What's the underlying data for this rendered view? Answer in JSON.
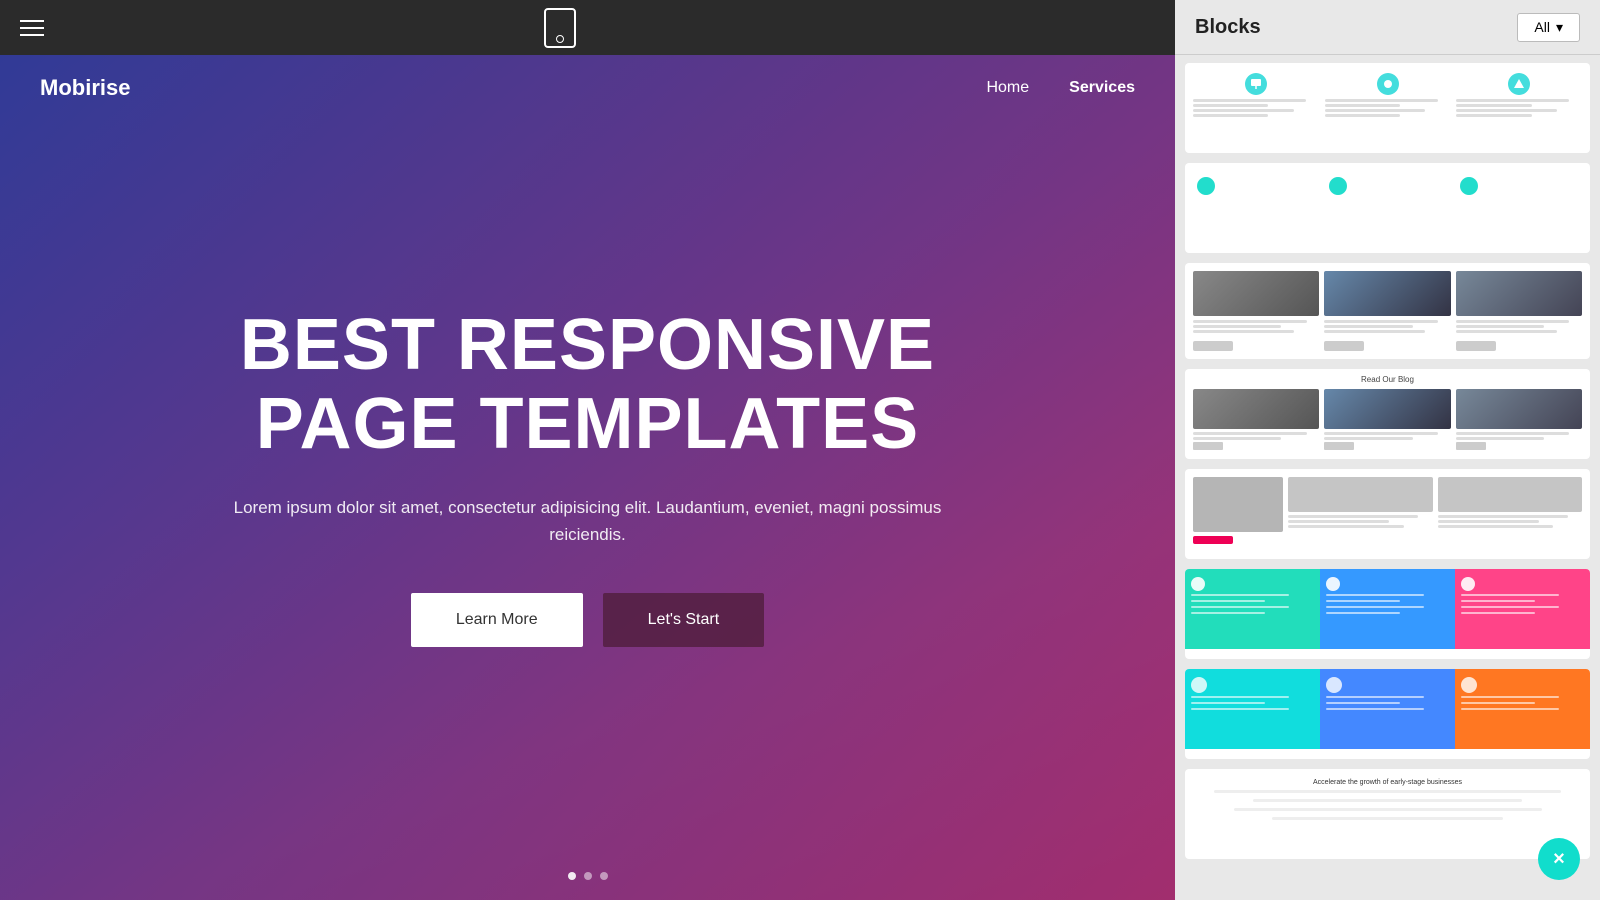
{
  "toolbar": {
    "device_icon_label": "mobile device"
  },
  "navbar": {
    "brand": "Mobirise",
    "links": [
      {
        "label": "Home",
        "active": false
      },
      {
        "label": "Services",
        "active": true
      }
    ]
  },
  "hero": {
    "title_line1": "BEST RESPONSIVE",
    "title_line2": "PAGE TEMPLATES",
    "subtitle": "Lorem ipsum dolor sit amet, consectetur adipisicing elit. Laudantium, eveniet, magni possimus reiciendis.",
    "btn_learn": "Learn More",
    "btn_start": "Let's Start"
  },
  "right_panel": {
    "title": "Blocks",
    "dropdown_label": "All",
    "close_label": "×",
    "blocks": [
      {
        "id": 1,
        "type": "icon-cards"
      },
      {
        "id": 2,
        "type": "colored-icon-cards"
      },
      {
        "id": 3,
        "type": "image-cards"
      },
      {
        "id": 4,
        "type": "blog-cards",
        "header": "Read Our Blog"
      },
      {
        "id": 5,
        "type": "news-article"
      },
      {
        "id": 6,
        "type": "colored-features"
      },
      {
        "id": 7,
        "type": "colored-sections"
      },
      {
        "id": 8,
        "type": "accelerate",
        "header": "Accelerate the growth of early-stage businesses"
      }
    ]
  }
}
